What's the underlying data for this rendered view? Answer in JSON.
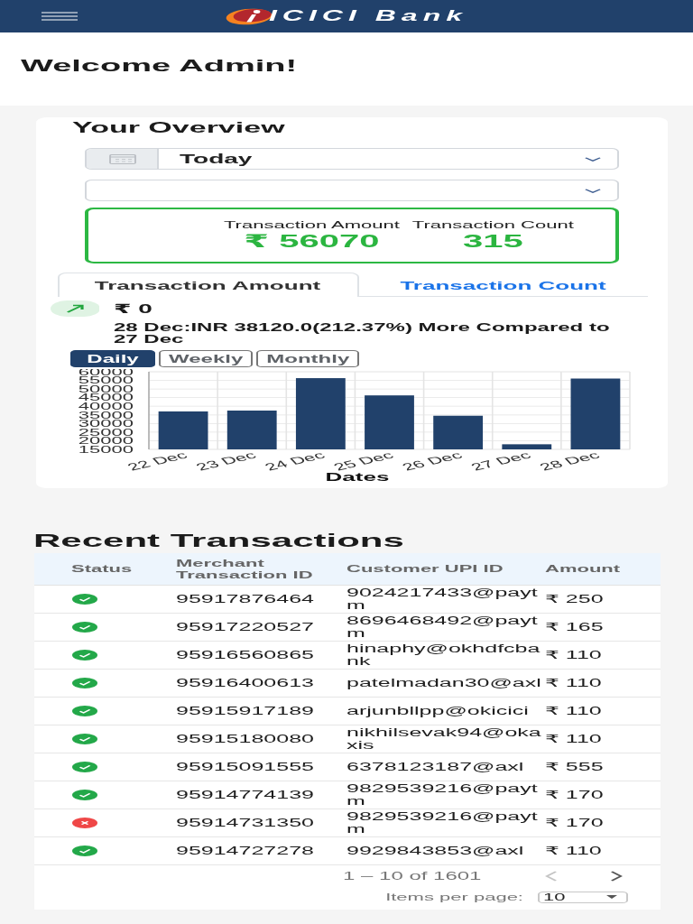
{
  "top_bar": {
    "logo_text": "ICICI Bank"
  },
  "welcome": "Welcome Admin!",
  "overview": {
    "title": "Your Overview",
    "date_select": {
      "value": "Today"
    },
    "summary": [
      {
        "label": "Transaction Amount",
        "value": "₹ 56070"
      },
      {
        "label": "Transaction Count",
        "value": "315"
      }
    ],
    "tabs": [
      {
        "label": "Transaction Amount",
        "selected": true
      },
      {
        "label": "Transaction Count",
        "selected": false
      }
    ],
    "trend": {
      "increased": true,
      "value": "₹ 0",
      "note": "28 Dec:INR 38120.0(212.37%) More Compared to 27 Dec"
    },
    "periods": [
      {
        "label": "Daily",
        "selected": true
      },
      {
        "label": "Weekly",
        "selected": false
      },
      {
        "label": "Monthly",
        "selected": false
      }
    ],
    "chart_data": {
      "type": "bar",
      "xlabel": "Dates",
      "categories": [
        "22 Dec",
        "23 Dec",
        "24 Dec",
        "25 Dec",
        "26 Dec",
        "27 Dec",
        "28 Dec"
      ],
      "values": [
        37000,
        37500,
        56300,
        46300,
        34500,
        17950,
        56070
      ],
      "ylim": [
        15000,
        60000
      ],
      "yticks": [
        15000,
        20000,
        25000,
        30000,
        35000,
        40000,
        45000,
        50000,
        55000,
        60000
      ],
      "grid": true
    }
  },
  "recent_transactions": {
    "title": "Recent Transactions",
    "columns": [
      "Status",
      "Merchant Transaction ID",
      "Customer UPI ID",
      "Amount"
    ],
    "rows": [
      {
        "successful": true,
        "merchant_transaction_id": "95917876464",
        "customer_upi_id": "9024217433@paytm",
        "amount": "₹ 250"
      },
      {
        "successful": true,
        "merchant_transaction_id": "95917220527",
        "customer_upi_id": "8696468492@paytm",
        "amount": "₹ 165"
      },
      {
        "successful": true,
        "merchant_transaction_id": "95916560865",
        "customer_upi_id": "hinaphy@okhdfcbank",
        "amount": "₹ 110"
      },
      {
        "successful": true,
        "merchant_transaction_id": "95916400613",
        "customer_upi_id": "patelmadan30@axl",
        "amount": "₹ 110"
      },
      {
        "successful": true,
        "merchant_transaction_id": "95915917189",
        "customer_upi_id": "arjunbllpp@okicici",
        "amount": "₹ 110"
      },
      {
        "successful": true,
        "merchant_transaction_id": "95915180080",
        "customer_upi_id": "nikhilsevak94@okaxis",
        "amount": "₹ 110"
      },
      {
        "successful": true,
        "merchant_transaction_id": "95915091555",
        "customer_upi_id": "6378123187@axl",
        "amount": "₹ 555"
      },
      {
        "successful": true,
        "merchant_transaction_id": "95914774139",
        "customer_upi_id": "9829539216@paytm",
        "amount": "₹ 170"
      },
      {
        "successful": false,
        "merchant_transaction_id": "95914731350",
        "customer_upi_id": "9829539216@paytm",
        "amount": "₹ 170"
      },
      {
        "successful": true,
        "merchant_transaction_id": "95914727278",
        "customer_upi_id": "9929843853@axl",
        "amount": "₹ 110"
      }
    ],
    "pagination": {
      "range": "1 – 10 of 1601",
      "prev": {
        "disabled": true
      },
      "next": {
        "disabled": false
      },
      "items_per_page_label": "Items per page:",
      "page_size": "10"
    }
  }
}
